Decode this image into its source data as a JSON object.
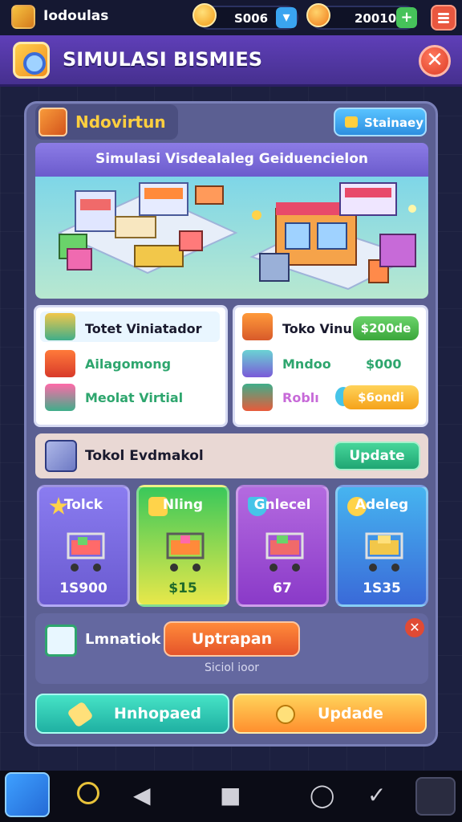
{
  "status_bar": {
    "app_name": "Iodoulas",
    "resource1": "S006",
    "resource2": "20010",
    "resource1_btn": "▾",
    "resource2_btn": "+"
  },
  "title": {
    "text": "SIMULASI BISMIES",
    "close": "✕"
  },
  "panel": {
    "header_label": "Ndovirtun",
    "stat_button": "Stainaey",
    "scene_title": "Simulasi Visdealaleg Geiduencielon"
  },
  "card_left": {
    "rows": [
      {
        "label": "Totet Viniatador"
      },
      {
        "label": "Ailagomong"
      },
      {
        "label": "Meolat Virtial"
      }
    ]
  },
  "card_right": {
    "rows": [
      {
        "label": "Toko Vinur",
        "value": "$200de"
      },
      {
        "label": "Mndoo",
        "value": "$000"
      },
      {
        "label": "Roblı",
        "value": "$6ondi"
      }
    ]
  },
  "update_row": {
    "label": "Tokol Evdmakol",
    "button": "Update"
  },
  "tiles": [
    {
      "label": "Tolck",
      "value": "1S900"
    },
    {
      "label": "Nling",
      "value": "$15"
    },
    {
      "label": "Gnlecel",
      "value": "67"
    },
    {
      "label": "Adeleg",
      "value": "1S35"
    }
  ],
  "lower": {
    "label": "Lmnatiok",
    "button": "Uptrapan",
    "close": "✕",
    "note": "Siciol ioor"
  },
  "bottom_buttons": {
    "left": "Hnhopaed",
    "right": "Updade"
  },
  "nav": {
    "back": "◀",
    "square": "■",
    "circle": "◯",
    "check": "✓"
  },
  "colors": {
    "title_bar": "#5f3fb8",
    "accent_gold": "#ffcf3f",
    "panel": "#5b5f92",
    "tile_blue": "#7b6ee0",
    "tile_green": "#9fdc3a",
    "tile_purple": "#a759d8",
    "tile_sky": "#3c8df0"
  },
  "icons": [
    "app-icon",
    "coin-icon",
    "store-icon",
    "cart-icon",
    "star-icon",
    "shield-icon",
    "gift-icon",
    "checklist-icon"
  ]
}
